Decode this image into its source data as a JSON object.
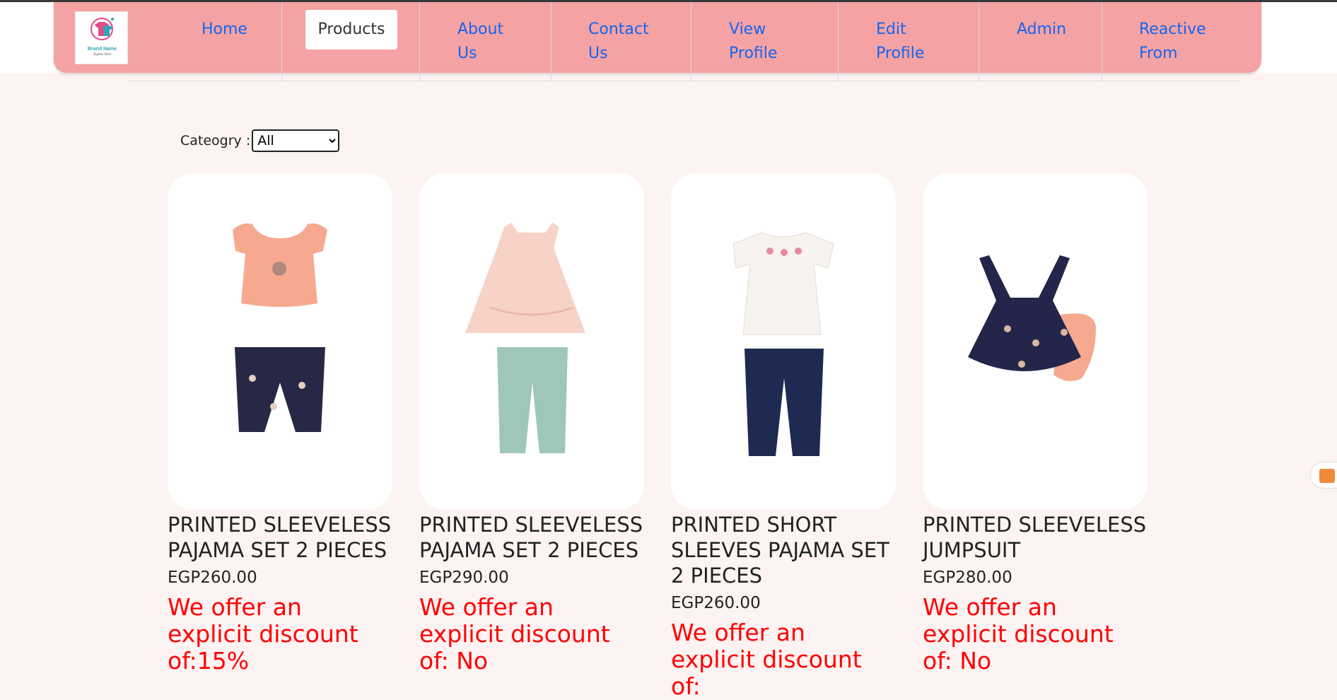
{
  "brand": {
    "name": "Brand Name",
    "tagline": "Tagline Here"
  },
  "nav": {
    "home": "Home",
    "products": "Products",
    "about_l1": "About",
    "about_l2": "Us",
    "contact_l1": "Contact",
    "contact_l2": "Us",
    "viewprofile_l1": "View",
    "viewprofile_l2": "Profile",
    "editprofile_l1": "Edit",
    "editprofile_l2": "Profile",
    "admin": "Admin",
    "reactive_l1": "Reactive",
    "reactive_l2": "From"
  },
  "filter": {
    "label": "Cateogry :",
    "selected": "All"
  },
  "products": [
    {
      "title": "PRINTED SLEEVELESS PAJAMA SET 2 PIECES",
      "price": "EGP260.00",
      "discount": "We offer an explicit discount of:15%",
      "top_color": "#f7a98f",
      "bottom_color": "#262846"
    },
    {
      "title": "PRINTED SLEEVELESS PAJAMA SET 2 PIECES",
      "price": "EGP290.00",
      "discount": "We offer an explicit discount of: No",
      "top_color": "#f7d3c7",
      "bottom_color": "#9fc7b9"
    },
    {
      "title": "PRINTED SHORT SLEEVES PAJAMA SET 2 PIECES",
      "price": "EGP260.00",
      "discount": "We offer an explicit discount of:",
      "top_color": "#f7f3ee",
      "bottom_color": "#1f2a52"
    },
    {
      "title": "PRINTED SLEEVELESS JUMPSUIT",
      "price": "EGP280.00",
      "discount": "We offer an explicit discount of: No",
      "top_color": "#23264a",
      "bottom_color": "#f6a98f"
    }
  ],
  "colors": {
    "navbar_bg": "#f4a2a3",
    "nav_link": "#1565f0",
    "page_bg": "#fdf3f2",
    "discount_text": "#ff0000"
  }
}
